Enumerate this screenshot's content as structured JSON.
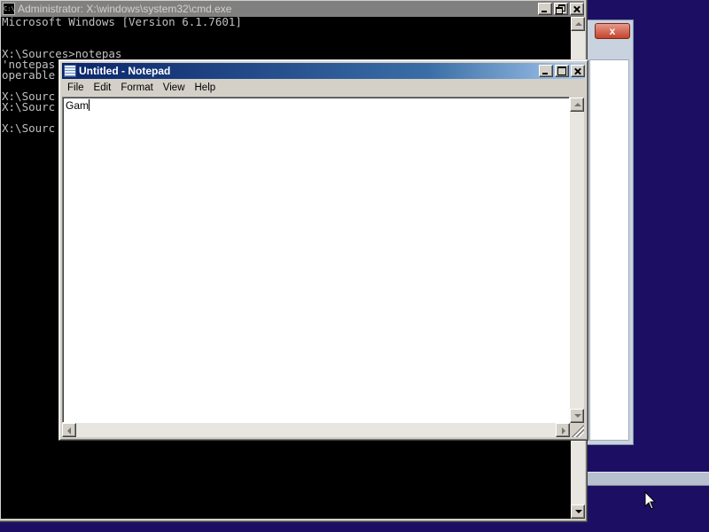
{
  "cmd_window": {
    "title": "Administrator: X:\\windows\\system32\\cmd.exe",
    "icon_label": "C:\\",
    "console_lines": [
      "Microsoft Windows [Version 6.1.7601]",
      "",
      "",
      "X:\\Sources>notepas",
      "'notepas",
      "operable",
      "",
      "X:\\Sourc",
      "X:\\Sourc",
      "",
      "X:\\Sourc"
    ]
  },
  "background_dialog": {
    "close_glyph": "x"
  },
  "notepad": {
    "title": "Untitled - Notepad",
    "menu": [
      "File",
      "Edit",
      "Format",
      "View",
      "Help"
    ],
    "content": "Gam"
  },
  "colors": {
    "desktop": "#1c0f63",
    "active_title_start": "#0a246a",
    "active_title_end": "#a6caf0",
    "inactive_title": "#808080",
    "console_bg": "#000000",
    "console_text": "#c0c0c0"
  }
}
